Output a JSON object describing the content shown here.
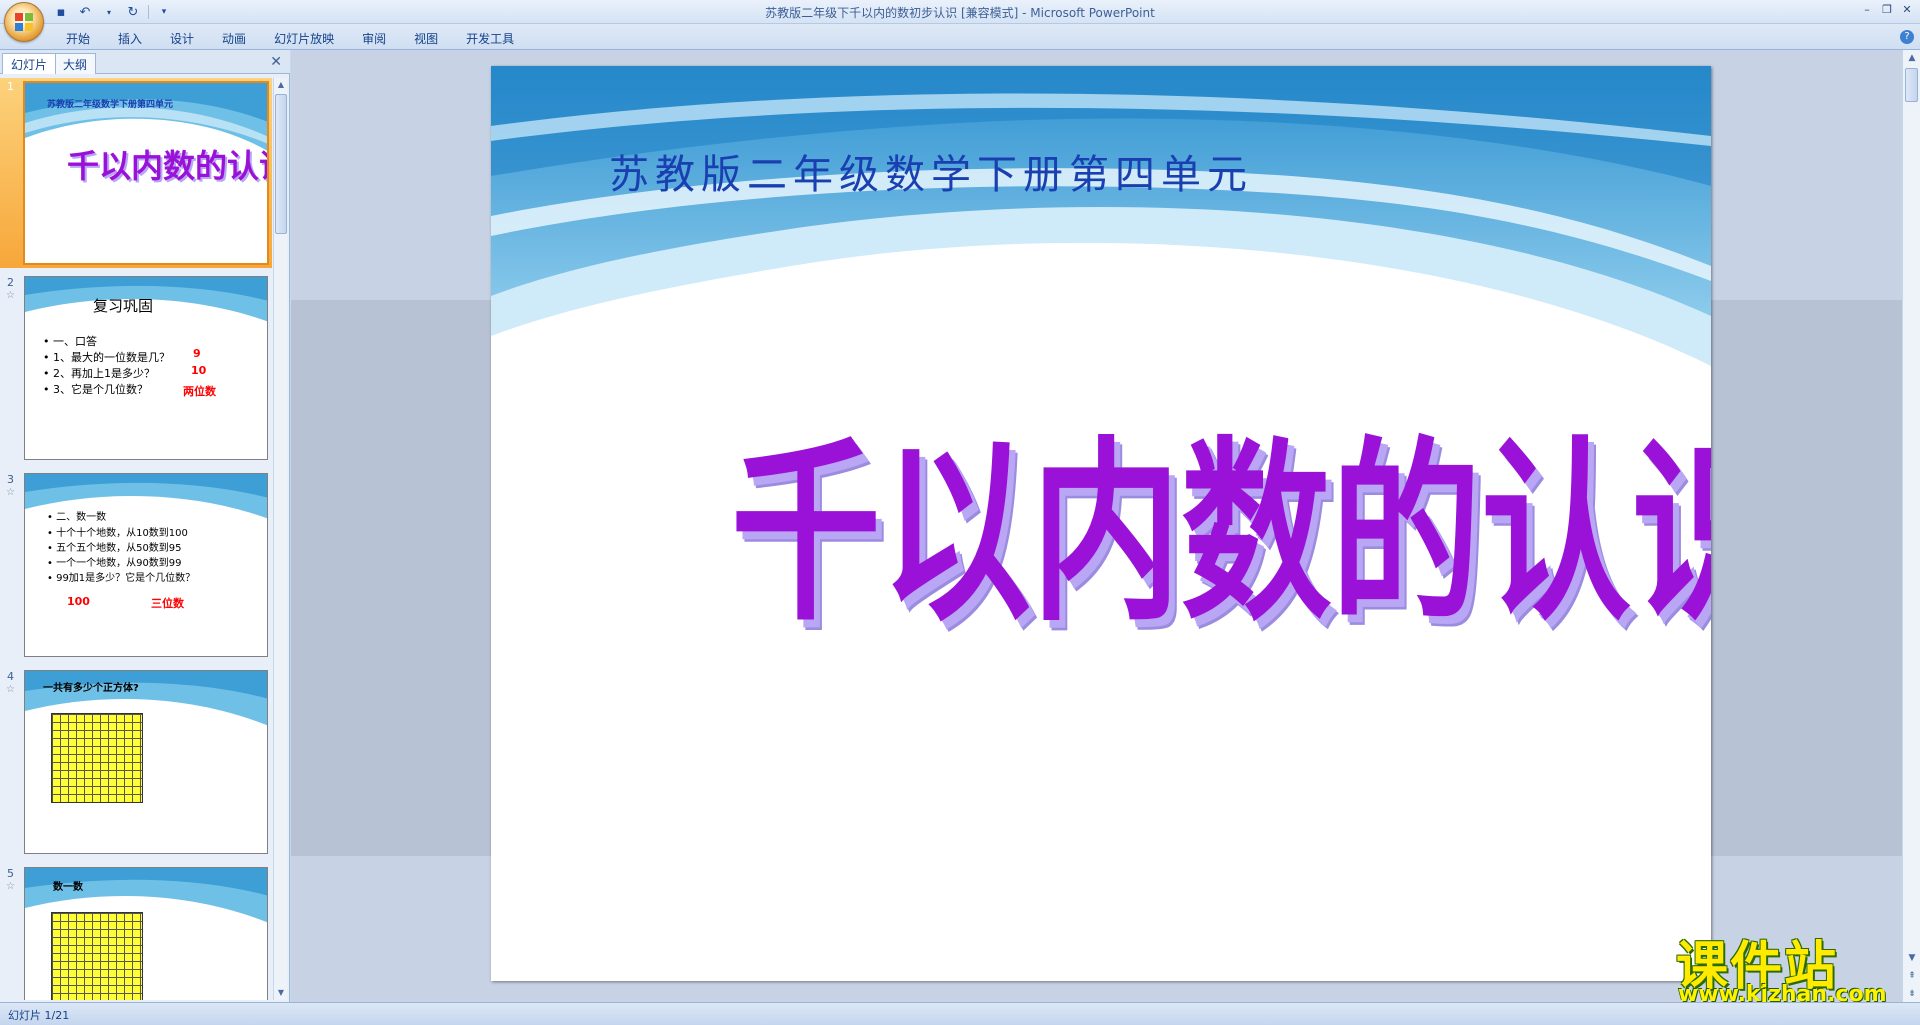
{
  "window": {
    "title": "苏教版二年级下千以内的数初步认识 [兼容模式] - Microsoft PowerPoint"
  },
  "ribbon": {
    "tabs": [
      "开始",
      "插入",
      "设计",
      "动画",
      "幻灯片放映",
      "审阅",
      "视图",
      "开发工具"
    ]
  },
  "panel": {
    "tabs": [
      "幻灯片",
      "大纲"
    ],
    "close": "✕"
  },
  "thumbnails": [
    {
      "num": "1",
      "subtitle": "苏教版二年级数学下册第四单元",
      "title": "千以内数的认识"
    },
    {
      "num": "2",
      "title": "复习巩固",
      "lines": [
        "• 一、口答",
        "• 1、最大的一位数是几？",
        "• 2、再加上1是多少？",
        "• 3、它是个几位数？"
      ],
      "answers": [
        "9",
        "10",
        "两位数"
      ]
    },
    {
      "num": "3",
      "lines": [
        "• 二、数一数",
        "• 十个十个地数，从10数到100",
        "• 五个五个地数，从50数到95",
        "• 一个一个地数，从90数到99",
        "• 99加1是多少？它是个几位数？"
      ],
      "answers": [
        "100",
        "三位数"
      ]
    },
    {
      "num": "4",
      "title": "一共有多少个正方体?"
    },
    {
      "num": "5",
      "title": "数一数"
    }
  ],
  "slide": {
    "subtitle": "苏教版二年级数学下册第四单元",
    "title": "千以内数的认识"
  },
  "watermark": {
    "text": "课件站",
    "url": "www.kjzhan.com"
  },
  "status": {
    "text": "幻灯片 1/21"
  },
  "colors": {
    "title_purple": "#9a12d8",
    "subtitle_blue": "#1a3fb0",
    "answer_red": "#ff0000",
    "selected_orange": "#f7a73a"
  }
}
